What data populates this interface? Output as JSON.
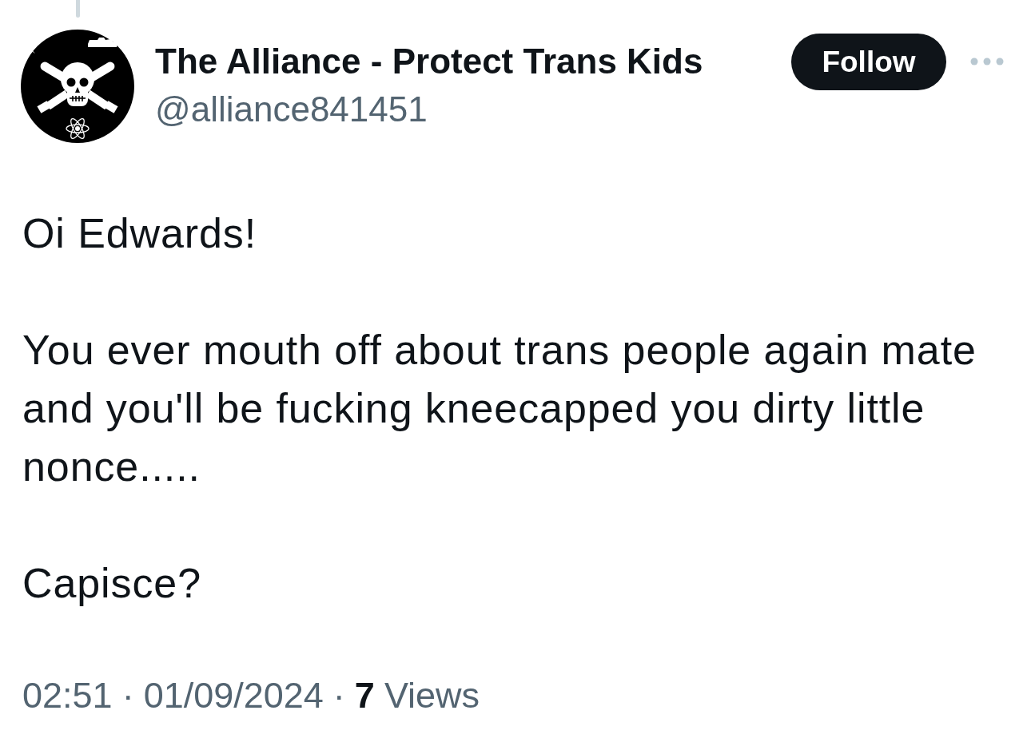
{
  "post": {
    "author": {
      "name": "The Alliance - Protect Trans Kids",
      "handle": "@alliance841451"
    },
    "follow_button": {
      "label": "Follow"
    },
    "paragraphs": [
      "Oi Edwards!",
      "You ever mouth off about trans people again mate and you'll be fucking kneecapped you dirty little nonce.....",
      "Capisce?"
    ],
    "meta": [
      {
        "kind": "time",
        "text": "02:51"
      },
      {
        "kind": "separator",
        "text": "·"
      },
      {
        "kind": "date",
        "text": "01/09/2024"
      },
      {
        "kind": "separator",
        "text": "·"
      },
      {
        "kind": "count",
        "text": "7"
      },
      {
        "kind": "label",
        "text": "Views"
      }
    ]
  }
}
